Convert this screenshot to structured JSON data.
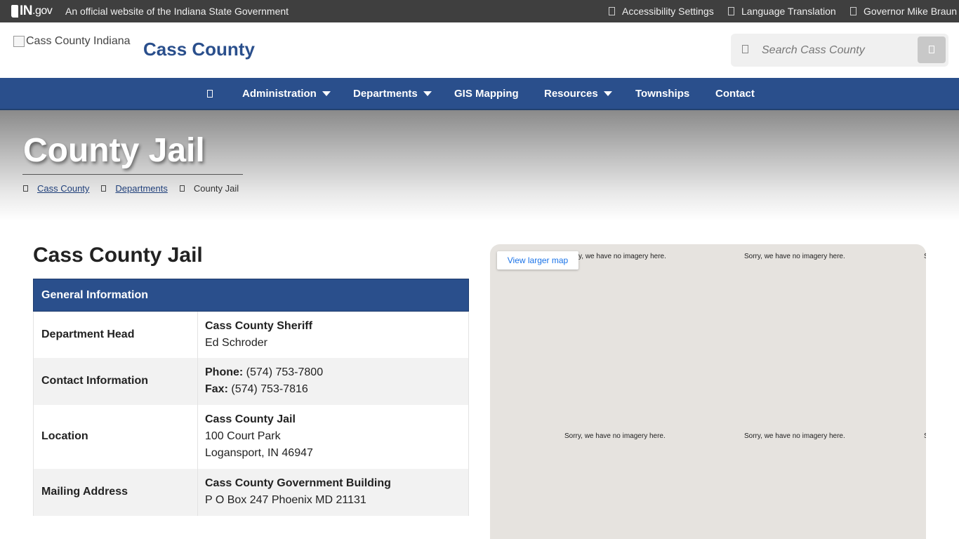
{
  "topbar": {
    "logo_text": "IN",
    "logo_suffix": ".gov",
    "official_text": "An official website of the Indiana State Government",
    "links": [
      {
        "label": "Accessibility Settings"
      },
      {
        "label": "Language Translation"
      },
      {
        "label": "Governor Mike Braun"
      }
    ]
  },
  "header": {
    "logo_alt": "Cass County Indiana",
    "site_title": "Cass County",
    "search_placeholder": "Search Cass County"
  },
  "nav": {
    "items": [
      {
        "label": "Administration",
        "dropdown": true
      },
      {
        "label": "Departments",
        "dropdown": true
      },
      {
        "label": "GIS Mapping",
        "dropdown": false
      },
      {
        "label": "Resources",
        "dropdown": true
      },
      {
        "label": "Townships",
        "dropdown": false
      },
      {
        "label": "Contact",
        "dropdown": false
      }
    ]
  },
  "hero": {
    "title": "County Jail",
    "breadcrumbs": [
      {
        "label": "Cass County",
        "link": true
      },
      {
        "label": "Departments",
        "link": true
      },
      {
        "label": "County Jail",
        "link": false
      }
    ]
  },
  "main": {
    "title": "Cass County Jail",
    "table": {
      "header": "General Information",
      "rows": [
        {
          "label": "Department Head",
          "line1_bold": "Cass County Sheriff",
          "line2": "Ed Schroder"
        },
        {
          "label": "Contact Information",
          "phone_label": "Phone:",
          "phone": "(574) 753-7800",
          "fax_label": "Fax:",
          "fax": "(574) 753-7816"
        },
        {
          "label": "Location",
          "line1_bold": "Cass County Jail",
          "line2": "100 Court Park",
          "line3": "Logansport, IN 46947"
        },
        {
          "label": "Mailing Address",
          "line1_bold": "Cass County Government Building",
          "line2": "P O Box 247 Phoenix MD 21131"
        }
      ]
    }
  },
  "map": {
    "larger_map_label": "View larger map",
    "no_imagery_text": "Sorry, we have no imagery here.",
    "no_imagery_fragment_1": "y, we have no imagery here.",
    "no_imagery_edge": "S"
  },
  "colors": {
    "brand_blue": "#2a4f8c",
    "topbar": "#3f3f3f"
  }
}
